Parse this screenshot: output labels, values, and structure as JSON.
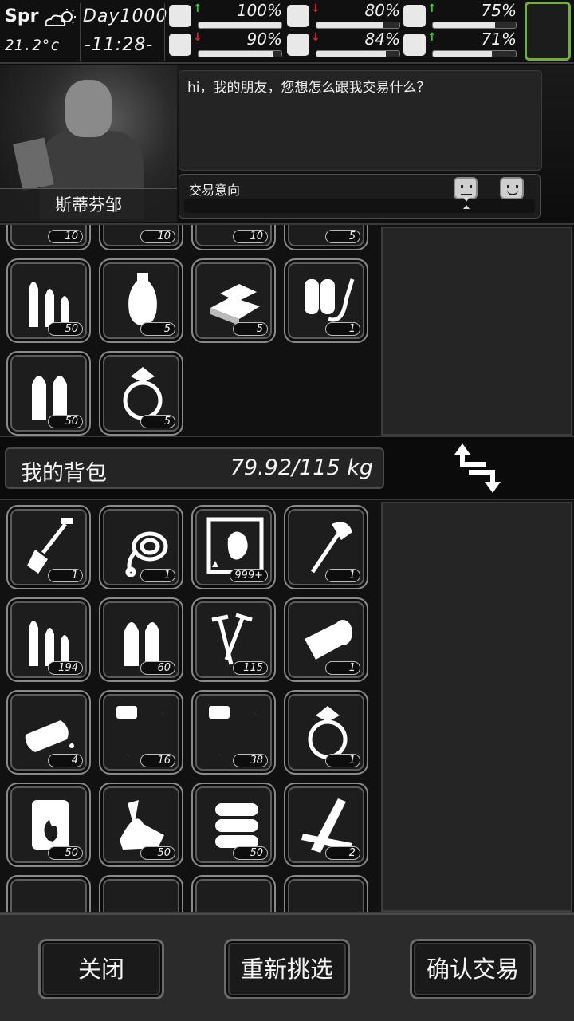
{
  "status": {
    "season": "Spr",
    "weather_icon": "sun-cloud-icon",
    "temperature": "21.2°c",
    "day": "Day1000",
    "time": "-11:28-",
    "stats": [
      {
        "icon": "medkit-icon",
        "trend": "up",
        "value": "100%",
        "level": 1.0
      },
      {
        "icon": "stomach-icon",
        "trend": "down",
        "value": "80%",
        "level": 0.8
      },
      {
        "icon": "pill-icon",
        "trend": "up",
        "value": "75%",
        "level": 0.75
      },
      {
        "icon": "foot-icon",
        "trend": "down",
        "value": "90%",
        "level": 0.9
      },
      {
        "icon": "water-drop-icon",
        "trend": "down",
        "value": "84%",
        "level": 0.84
      },
      {
        "icon": "heart-icon",
        "trend": "up",
        "value": "71%",
        "level": 0.71
      }
    ],
    "accent_color": "#6fae3a"
  },
  "trader": {
    "name": "斯蒂芬邹",
    "dialog": "hi，我的朋友，您想怎么跟我交易什么？",
    "intent_label": "交易意向"
  },
  "trader_items": [
    {
      "icon": "item-icon",
      "qty": "10"
    },
    {
      "icon": "item-icon",
      "qty": "10"
    },
    {
      "icon": "item-icon",
      "qty": "10"
    },
    {
      "icon": "item-icon",
      "qty": "5"
    },
    {
      "icon": "rifle-ammo-icon",
      "qty": "50"
    },
    {
      "icon": "vase-icon",
      "qty": "5"
    },
    {
      "icon": "gold-bars-icon",
      "qty": "5"
    },
    {
      "icon": "flamethrower-icon",
      "qty": "1"
    },
    {
      "icon": "pistol-ammo-icon",
      "qty": "50"
    },
    {
      "icon": "diamond-ring-icon",
      "qty": "5"
    }
  ],
  "backpack": {
    "title": "我的背包",
    "weight": "79.92/115 kg"
  },
  "player_items": [
    {
      "icon": "shovel-icon",
      "qty": "1"
    },
    {
      "icon": "rope-icon",
      "qty": "1"
    },
    {
      "icon": "map-icon",
      "qty": "999+"
    },
    {
      "icon": "axe-icon",
      "qty": "1"
    },
    {
      "icon": "rifle-ammo-icon",
      "qty": "194"
    },
    {
      "icon": "pistol-ammo-icon",
      "qty": "60"
    },
    {
      "icon": "nails-icon",
      "qty": "115"
    },
    {
      "icon": "bandage-roll-icon",
      "qty": "1"
    },
    {
      "icon": "bread-icon",
      "qty": "4"
    },
    {
      "icon": "test-tube-vii-icon",
      "qty": "16"
    },
    {
      "icon": "test-tube-vi-icon",
      "qty": "38"
    },
    {
      "icon": "diamond-ring-icon",
      "qty": "1"
    },
    {
      "icon": "fuel-barrel-icon",
      "qty": "50"
    },
    {
      "icon": "scrap-metal-icon",
      "qty": "50"
    },
    {
      "icon": "logs-icon",
      "qty": "50"
    },
    {
      "icon": "planks-icon",
      "qty": "2"
    },
    {
      "icon": "rock-icon",
      "qty": ""
    },
    {
      "icon": "stone-icon",
      "qty": ""
    },
    {
      "icon": "bottle-icon",
      "qty": ""
    },
    {
      "icon": "ingot-icon",
      "qty": ""
    }
  ],
  "footer": {
    "close": "关闭",
    "reselect": "重新挑选",
    "confirm": "确认交易"
  }
}
